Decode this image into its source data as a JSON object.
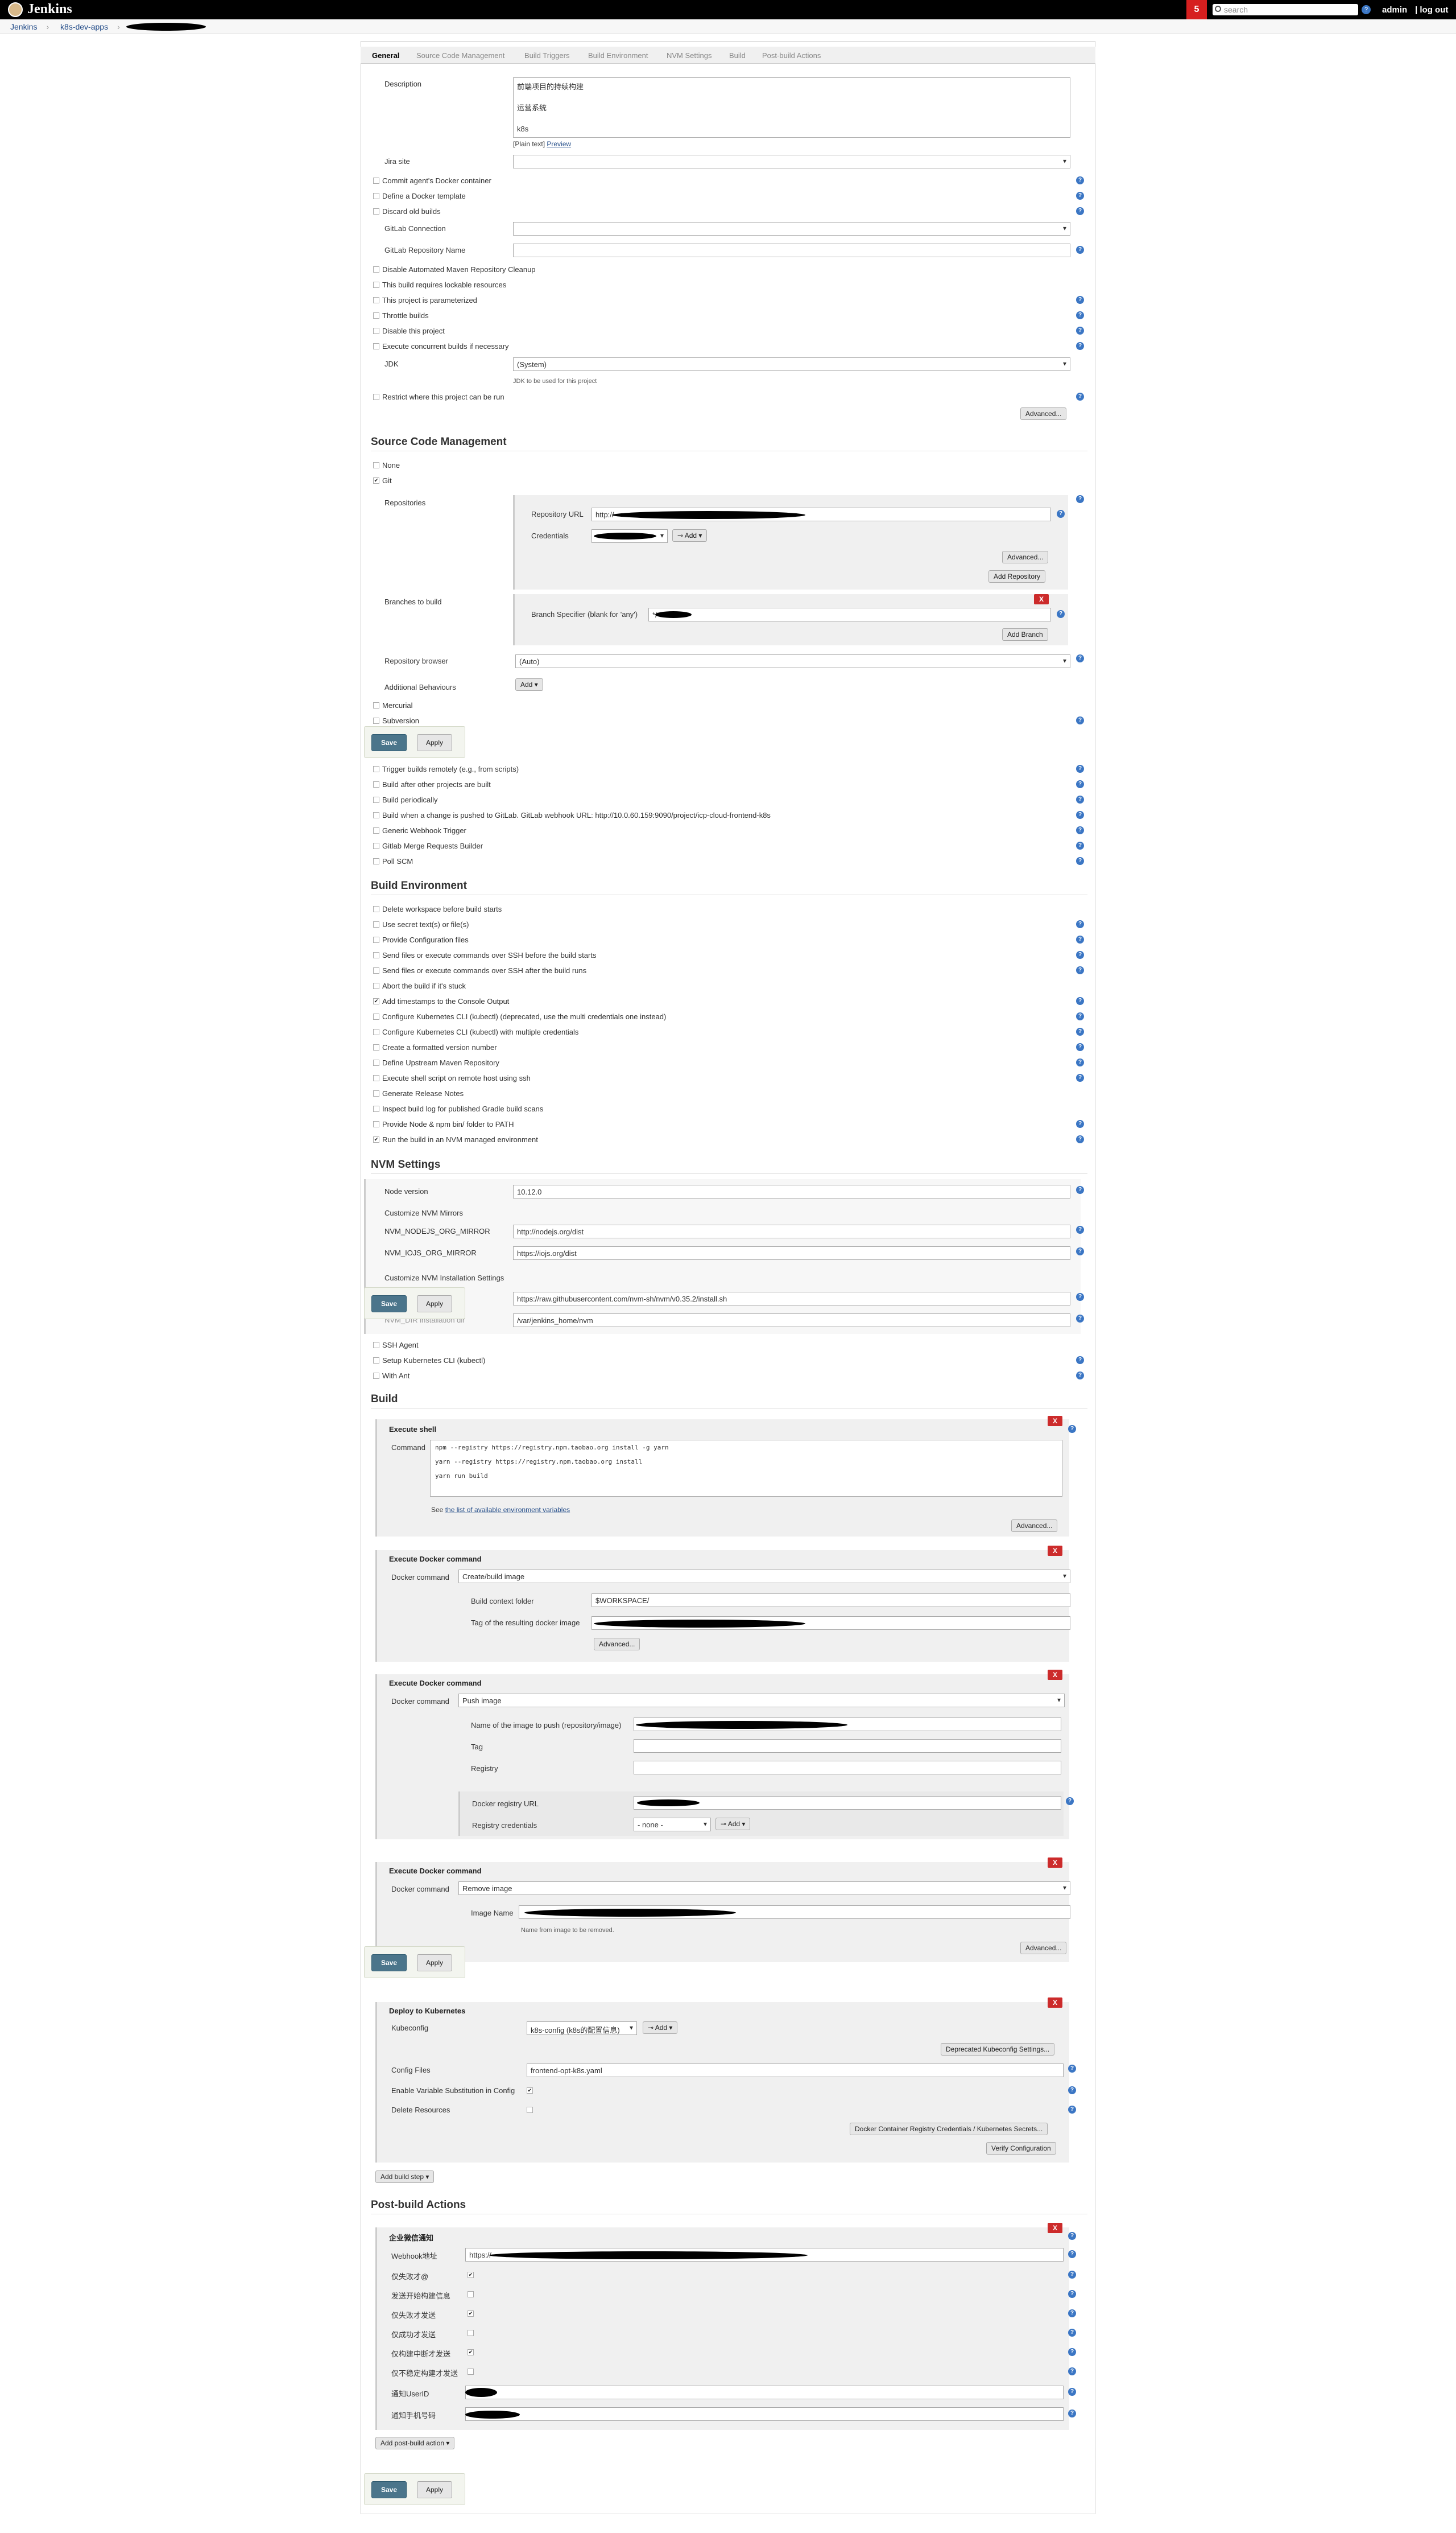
{
  "header": {
    "logo": "Jenkins",
    "notifications": "5",
    "search_placeholder": "search",
    "user": "admin",
    "logout": "log out"
  },
  "breadcrumbs": [
    "Jenkins",
    "k8s-dev-apps"
  ],
  "tabs": [
    "General",
    "Source Code Management",
    "Build Triggers",
    "Build Environment",
    "NVM Settings",
    "Build",
    "Post-build Actions"
  ],
  "general": {
    "description_label": "Description",
    "description_lines": [
      "前端项目的持续构建",
      "运营系统",
      "k8s"
    ],
    "plain_text": "[Plain text]",
    "preview": "Preview",
    "jira_site": "Jira site",
    "options_a": [
      "Commit agent's Docker container",
      "Define a Docker template",
      "Discard old builds"
    ],
    "gitlab_connection": "GitLab Connection",
    "gitlab_repo_name": "GitLab Repository Name",
    "options_b": [
      "Disable Automated Maven Repository Cleanup",
      "This build requires lockable resources",
      "This project is parameterized",
      "Throttle builds",
      "Disable this project",
      "Execute concurrent builds if necessary"
    ],
    "jdk_label": "JDK",
    "jdk_value": "(System)",
    "jdk_hint": "JDK to be used for this project",
    "restrict": "Restrict where this project can be run",
    "advanced": "Advanced..."
  },
  "scm": {
    "title": "Source Code Management",
    "none": "None",
    "git": "Git",
    "repositories": "Repositories",
    "repo_url_label": "Repository URL",
    "repo_url": "http://",
    "credentials_label": "Credentials",
    "add": "Add",
    "advanced": "Advanced...",
    "add_repository": "Add Repository",
    "branches_label": "Branches to build",
    "branch_specifier_label": "Branch Specifier (blank for 'any')",
    "branch_value": "*/",
    "add_branch": "Add Branch",
    "repo_browser_label": "Repository browser",
    "repo_browser": "(Auto)",
    "additional_behaviours": "Additional Behaviours",
    "mercurial": "Mercurial",
    "subversion": "Subversion"
  },
  "triggers": [
    "Trigger builds remotely (e.g., from scripts)",
    "Build after other projects are built",
    "Build periodically",
    "Build when a change is pushed to GitLab. GitLab webhook URL: http://10.0.60.159:9090/project/icp-cloud-frontend-k8s",
    "Generic Webhook Trigger",
    "Gitlab Merge Requests Builder",
    "Poll SCM"
  ],
  "build_env": {
    "title": "Build Environment",
    "options": [
      "Delete workspace before build starts",
      "Use secret text(s) or file(s)",
      "Provide Configuration files",
      "Send files or execute commands over SSH before the build starts",
      "Send files or execute commands over SSH after the build runs",
      "Abort the build if it's stuck",
      "Add timestamps to the Console Output",
      "Configure Kubernetes CLI (kubectl) (deprecated, use the multi credentials one instead)",
      "Configure Kubernetes CLI (kubectl) with multiple credentials",
      "Create a formatted version number",
      "Define Upstream Maven Repository",
      "Execute shell script on remote host using ssh",
      "Generate Release Notes",
      "Inspect build log for published Gradle build scans",
      "Provide Node & npm bin/ folder to PATH",
      "Run the build in an NVM managed environment"
    ],
    "checked": [
      6,
      15
    ]
  },
  "nvm": {
    "title": "NVM Settings",
    "node_version_label": "Node version",
    "node_version": "10.12.0",
    "customize_mirrors": "Customize NVM Mirrors",
    "nodejs_mirror_label": "NVM_NODEJS_ORG_MIRROR",
    "nodejs_mirror": "http://nodejs.org/dist",
    "iojs_mirror_label": "NVM_IOJS_ORG_MIRROR",
    "iojs_mirror": "https://iojs.org/dist",
    "customize_install": "Customize NVM Installation Settings",
    "install_url": "https://raw.githubusercontent.com/nvm-sh/nvm/v0.35.2/install.sh",
    "install_dir_label": "NVM_DIR installation dir",
    "install_dir": "/var/jenkins_home/nvm",
    "options": [
      "SSH Agent",
      "Setup Kubernetes CLI (kubectl)",
      "With Ant"
    ]
  },
  "build": {
    "title": "Build",
    "shell": {
      "title": "Execute shell",
      "command_label": "Command",
      "lines": [
        "npm --registry https://registry.npm.taobao.org install -g yarn",
        "yarn --registry https://registry.npm.taobao.org install",
        "yarn run build"
      ],
      "see": "See ",
      "env_link": "the list of available environment variables",
      "advanced": "Advanced..."
    },
    "docker1": {
      "title": "Execute Docker command",
      "command_label": "Docker command",
      "command": "Create/build image",
      "context_label": "Build context folder",
      "context": "$WORKSPACE/",
      "tag_label": "Tag of the resulting docker image",
      "advanced": "Advanced..."
    },
    "docker2": {
      "title": "Execute Docker command",
      "command_label": "Docker command",
      "command": "Push image",
      "name_label": "Name of the image to push (repository/image)",
      "tag_label": "Tag",
      "registry_label": "Registry",
      "registry_url_label": "Docker registry URL",
      "registry_cred_label": "Registry credentials",
      "registry_cred": "- none -",
      "add": "Add"
    },
    "docker3": {
      "title": "Execute Docker command",
      "command_label": "Docker command",
      "command": "Remove image",
      "image_label": "Image Name",
      "hint": "Name from image to be removed.",
      "advanced": "Advanced..."
    },
    "k8s": {
      "title": "Deploy to Kubernetes",
      "kubeconfig_label": "Kubeconfig",
      "kubeconfig": "k8s-config (k8s的配置信息)",
      "add": "Add",
      "deprecated": "Deprecated Kubeconfig Settings...",
      "config_files_label": "Config Files",
      "config_files": "frontend-opt-k8s.yaml",
      "var_sub": "Enable Variable Substitution in Config",
      "delete_res": "Delete Resources",
      "docker_cred": "Docker Container Registry Credentials / Kubernetes Secrets...",
      "verify": "Verify Configuration"
    },
    "add_step": "Add build step"
  },
  "post": {
    "title": "Post-build Actions",
    "step_title": "企业微信通知",
    "webhook_label": "Webhook地址",
    "webhook": "https://",
    "rows": [
      "仅失败才@",
      "发送开始构建信息",
      "仅失败才发送",
      "仅成功才发送",
      "仅构建中断才发送",
      "仅不稳定构建才发送"
    ],
    "rows_checked": [
      0,
      2,
      4
    ],
    "userid_label": "通知UserID",
    "mobile_label": "通知手机号码",
    "add_action": "Add post-build action"
  },
  "buttons": {
    "save": "Save",
    "apply": "Apply"
  }
}
